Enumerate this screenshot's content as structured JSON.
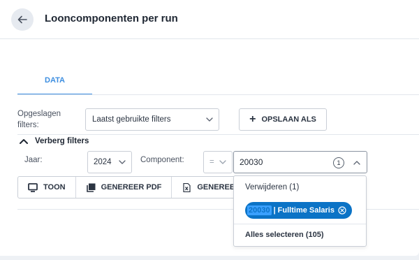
{
  "header": {
    "title": "Looncomponenten per run",
    "back_icon": "arrow-left-icon"
  },
  "tabs": [
    {
      "label": "DATA",
      "active": true
    }
  ],
  "saved_filters": {
    "label": "Opgeslagen filters:",
    "selected": "Laatst gebruikte filters",
    "save_as_label": "OPSLAAN ALS"
  },
  "filters": {
    "toggle_label": "Verberg filters",
    "year_label": "Jaar:",
    "year_value": "2024",
    "component_label": "Component:",
    "operator_value": "=",
    "component_value": "20030",
    "selected_count": "1"
  },
  "actions": {
    "show_label": "TOON",
    "pdf_label": "GENEREER PDF",
    "excel_label": "GENEREER"
  },
  "dropdown": {
    "remove_label": "Verwijderen (1)",
    "chip_code": "20030",
    "chip_separator": "|",
    "chip_text": "Fulltime Salaris",
    "select_all_label": "Alles selecteren (105)"
  },
  "colors": {
    "accent": "#3d8ee0",
    "chip": "#0b73c6",
    "background": "#eef1f5"
  }
}
